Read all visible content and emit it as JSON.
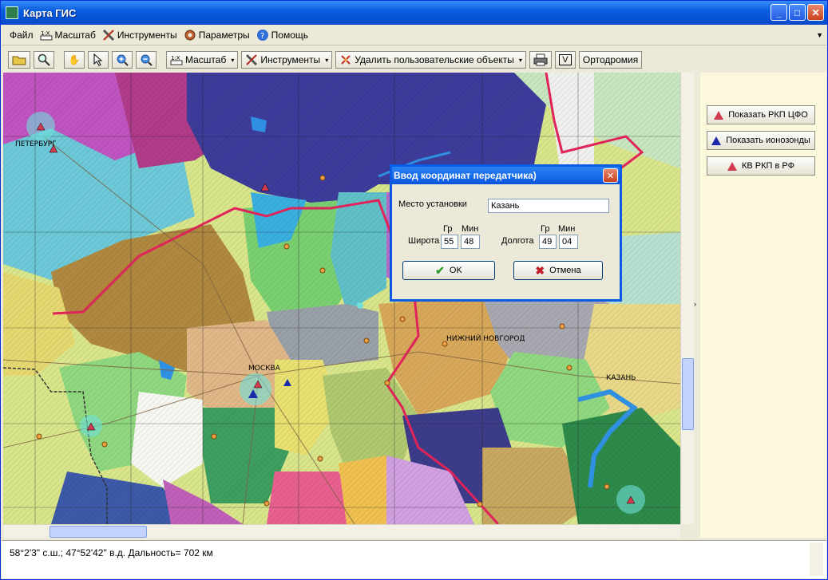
{
  "window": {
    "title": "Карта ГИС",
    "minimize": "_",
    "maximize": "□",
    "close": "✕"
  },
  "menu": {
    "items": [
      {
        "label": "Файл",
        "icon": "none"
      },
      {
        "label": "Масштаб",
        "icon": "scale-icon"
      },
      {
        "label": "Инструменты",
        "icon": "tools-icon"
      },
      {
        "label": "Параметры",
        "icon": "settings-icon"
      },
      {
        "label": "Помощь",
        "icon": "help-icon"
      }
    ],
    "overflow": "▼"
  },
  "toolbar": {
    "scale_label": "Масштаб",
    "tools_label": "Инструменты",
    "delete_label": "Удалить пользовательские объекты",
    "check_label": "V",
    "ortho_label": "Ортодромия",
    "dropdown_glyph": "▾"
  },
  "map": {
    "labels": {
      "moscow": "МОСКВА",
      "nizhny": "НИЖНИЙ НОВГОРОД",
      "kazan": "КАЗАНЬ",
      "spb": "ПЕТЕРБУРГ"
    }
  },
  "right_panel": {
    "buttons": [
      {
        "label": "Показать РКП ЦФО",
        "marker": "red"
      },
      {
        "label": "Показать ионозонды",
        "marker": "blue"
      },
      {
        "label": "КВ РКП в РФ",
        "marker": "red"
      }
    ]
  },
  "dialog": {
    "title": "Ввод координат передатчика)",
    "close": "✕",
    "place_label": "Место установки",
    "place_value": "Казань",
    "deg_label": "Гр",
    "min_label": "Мин",
    "lat_label": "Широта",
    "lat_deg": "55",
    "lat_min": "48",
    "lon_label": "Долгота",
    "lon_deg": "49",
    "lon_min": "04",
    "ok_label": "OK",
    "cancel_label": "Отмена"
  },
  "status": {
    "text": "58°2'3\" с.ш.; 47°52'42\" в.д.  Дальность= 702 км"
  },
  "colors": {
    "title_bar": "#0a5fe0",
    "border_red": "#e0245a",
    "panel_bg": "#fbf8dc"
  }
}
